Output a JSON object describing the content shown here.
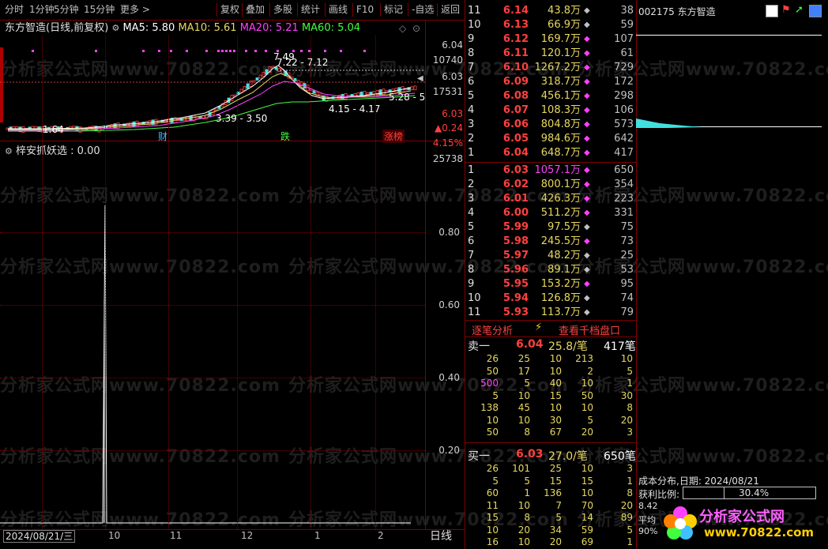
{
  "toolbar": {
    "items": [
      "分时",
      "1分钟",
      "5分钟",
      "15分钟",
      "更多 >",
      "复权",
      "叠加",
      "多股",
      "统计",
      "画线",
      "F10",
      "标记",
      "-自选",
      "返回"
    ]
  },
  "chart_header": {
    "stock": "东方智造",
    "mode": "(日线,前复权)",
    "ma5": "MA5: 5.80",
    "ma10": "MA10: 5.61",
    "ma20": "MA20: 5.21",
    "ma60": "MA60: 5.04",
    "colors": {
      "ma5": "#ffffff",
      "ma10": "#e8d860",
      "ma20": "#ff40ff",
      "ma60": "#40ff40"
    }
  },
  "price_annotations": {
    "high": "7.49",
    "high2": "7.22 - 7.12",
    "low1": "1.64",
    "mid": "3.39 - 3.50",
    "mid2": "4.15 - 4.17",
    "right": "5.28 - 5"
  },
  "price_axis": {
    "p1": "6.04",
    "v1": "10740",
    "p2": "6.03",
    "v2": "17531",
    "p3": "6.03",
    "chg": "▲0.24",
    "pct": "4.15%",
    "v3": "25738"
  },
  "events": {
    "e1": "财",
    "e2": "跌",
    "e3": "涨榜"
  },
  "indicator": {
    "title": "梓安抓妖选 : 0.00",
    "axis": [
      "0.80",
      "0.60",
      "0.40",
      "0.20"
    ]
  },
  "x_axis": {
    "date": "2024/08/21/三",
    "ticks": [
      "10",
      "11",
      "12",
      "1",
      "2"
    ],
    "period": "日线"
  },
  "watermark": {
    "text": "分析家公式网www.70822.com"
  },
  "sell_levels": [
    {
      "idx": "11",
      "price": "6.14",
      "vol": "43.8万",
      "cnt": "38",
      "dia": "◆",
      "dc": "#c0c0c0"
    },
    {
      "idx": "10",
      "price": "6.13",
      "vol": "66.9万",
      "cnt": "59",
      "dia": "◆",
      "dc": "#c0c0c0"
    },
    {
      "idx": "9",
      "price": "6.12",
      "vol": "169.7万",
      "cnt": "107",
      "dia": "◆",
      "dc": "#ff40ff"
    },
    {
      "idx": "8",
      "price": "6.11",
      "vol": "120.1万",
      "cnt": "61",
      "dia": "◆",
      "dc": "#ff40ff"
    },
    {
      "idx": "7",
      "price": "6.10",
      "vol": "1267.2万",
      "cnt": "729",
      "dia": "◆",
      "dc": "#ff40ff"
    },
    {
      "idx": "6",
      "price": "6.09",
      "vol": "318.7万",
      "cnt": "172",
      "dia": "◆",
      "dc": "#ff40ff"
    },
    {
      "idx": "5",
      "price": "6.08",
      "vol": "456.1万",
      "cnt": "298",
      "dia": "◆",
      "dc": "#ff40ff"
    },
    {
      "idx": "4",
      "price": "6.07",
      "vol": "108.3万",
      "cnt": "106",
      "dia": "◆",
      "dc": "#ff40ff"
    },
    {
      "idx": "3",
      "price": "6.06",
      "vol": "804.8万",
      "cnt": "573",
      "dia": "◆",
      "dc": "#ff40ff"
    },
    {
      "idx": "2",
      "price": "6.05",
      "vol": "984.6万",
      "cnt": "642",
      "dia": "◆",
      "dc": "#ff40ff"
    },
    {
      "idx": "1",
      "price": "6.04",
      "vol": "648.7万",
      "cnt": "417",
      "dia": "◆",
      "dc": "#ff40ff"
    }
  ],
  "buy_levels": [
    {
      "idx": "1",
      "price": "6.03",
      "vol": "1057.1万",
      "cnt": "650",
      "dia": "◆",
      "dc": "#ff40ff",
      "vc": "#ff40ff"
    },
    {
      "idx": "2",
      "price": "6.02",
      "vol": "800.1万",
      "cnt": "354",
      "dia": "◆",
      "dc": "#ff40ff",
      "vc": "#e8d860"
    },
    {
      "idx": "3",
      "price": "6.01",
      "vol": "426.3万",
      "cnt": "223",
      "dia": "◆",
      "dc": "#ff40ff",
      "vc": "#e8d860"
    },
    {
      "idx": "4",
      "price": "6.00",
      "vol": "511.2万",
      "cnt": "331",
      "dia": "◆",
      "dc": "#ff40ff",
      "vc": "#e8d860"
    },
    {
      "idx": "5",
      "price": "5.99",
      "vol": "97.5万",
      "cnt": "75",
      "dia": "◆",
      "dc": "#c0c0c0",
      "vc": "#e8d860"
    },
    {
      "idx": "6",
      "price": "5.98",
      "vol": "245.5万",
      "cnt": "73",
      "dia": "◆",
      "dc": "#ff40ff",
      "vc": "#e8d860"
    },
    {
      "idx": "7",
      "price": "5.97",
      "vol": "48.2万",
      "cnt": "25",
      "dia": "◆",
      "dc": "#c0c0c0",
      "vc": "#e8d860"
    },
    {
      "idx": "8",
      "price": "5.96",
      "vol": "89.1万",
      "cnt": "53",
      "dia": "◆",
      "dc": "#c0c0c0",
      "vc": "#e8d860"
    },
    {
      "idx": "9",
      "price": "5.95",
      "vol": "153.2万",
      "cnt": "95",
      "dia": "◆",
      "dc": "#ff40ff",
      "vc": "#e8d860"
    },
    {
      "idx": "10",
      "price": "5.94",
      "vol": "126.8万",
      "cnt": "74",
      "dia": "◆",
      "dc": "#c0c0c0",
      "vc": "#e8d860"
    },
    {
      "idx": "11",
      "price": "5.93",
      "vol": "113.7万",
      "cnt": "79",
      "dia": "◆",
      "dc": "#c0c0c0",
      "vc": "#e8d860"
    }
  ],
  "tabs": {
    "tick": "逐笔分析",
    "bolt": "⚡",
    "thousand": "查看千档盘口"
  },
  "sell_one": {
    "label": "卖一",
    "price": "6.04",
    "avg": "25.8/笔",
    "cnt": "417笔",
    "rows": [
      [
        "26",
        "25",
        "10",
        "213",
        "10"
      ],
      [
        "50",
        "17",
        "10",
        "2",
        "5"
      ],
      [
        "500",
        "5",
        "40",
        "10",
        "1"
      ],
      [
        "5",
        "10",
        "15",
        "50",
        "30"
      ],
      [
        "138",
        "45",
        "10",
        "10",
        "8"
      ],
      [
        "10",
        "10",
        "30",
        "5",
        "20"
      ],
      [
        "50",
        "8",
        "67",
        "20",
        "3"
      ]
    ]
  },
  "buy_one": {
    "label": "买一",
    "price": "6.03",
    "avg": "27.0/笔",
    "cnt": "650笔",
    "rows": [
      [
        "26",
        "101",
        "25",
        "10",
        "3"
      ],
      [
        "5",
        "5",
        "15",
        "15",
        "1"
      ],
      [
        "60",
        "1",
        "136",
        "10",
        "8"
      ],
      [
        "11",
        "10",
        "7",
        "70",
        "20"
      ],
      [
        "15",
        "8",
        "5",
        "14",
        "89"
      ],
      [
        "10",
        "20",
        "34",
        "59",
        "5"
      ],
      [
        "16",
        "10",
        "20",
        "69",
        "1"
      ]
    ]
  },
  "far_right": {
    "code": "002175 东方智造",
    "dist": "成本分布,日期: 2024/08/21",
    "profit_label": "获利比例:",
    "profit_value": "30.4%",
    "profit_ratio": 0.304,
    "l1": "8.42",
    "l2": "平均",
    "l3": "90%",
    "logo_text": "分析家公式网",
    "logo_url": "www.70822.com"
  }
}
